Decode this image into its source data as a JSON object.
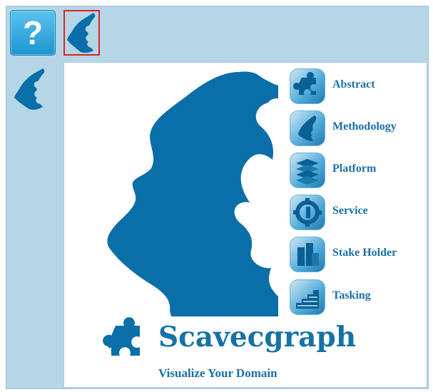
{
  "toolbar": {
    "help_label": "?",
    "help_icon": "help-icon",
    "thumbnail_icon": "scavecgraph-face-icon"
  },
  "sidebar": {
    "icon": "scavecgraph-face-icon"
  },
  "menu": {
    "items": [
      {
        "label": "Abstract",
        "icon": "puzzle-icon"
      },
      {
        "label": "Methodology",
        "icon": "face-puzzle-icon"
      },
      {
        "label": "Platform",
        "icon": "stack-layers-icon"
      },
      {
        "label": "Service",
        "icon": "gear-puzzle-icon"
      },
      {
        "label": "Stake Holder",
        "icon": "buildings-icon"
      },
      {
        "label": "Tasking",
        "icon": "stairs-icon"
      }
    ]
  },
  "brand": {
    "title": "Scavecgraph",
    "subtitle": "Visualize Your Domain"
  },
  "colors": {
    "brand_blue": "#0a6ea8",
    "frame_bg": "#b4d6e6",
    "selection_border": "#e0211f"
  }
}
